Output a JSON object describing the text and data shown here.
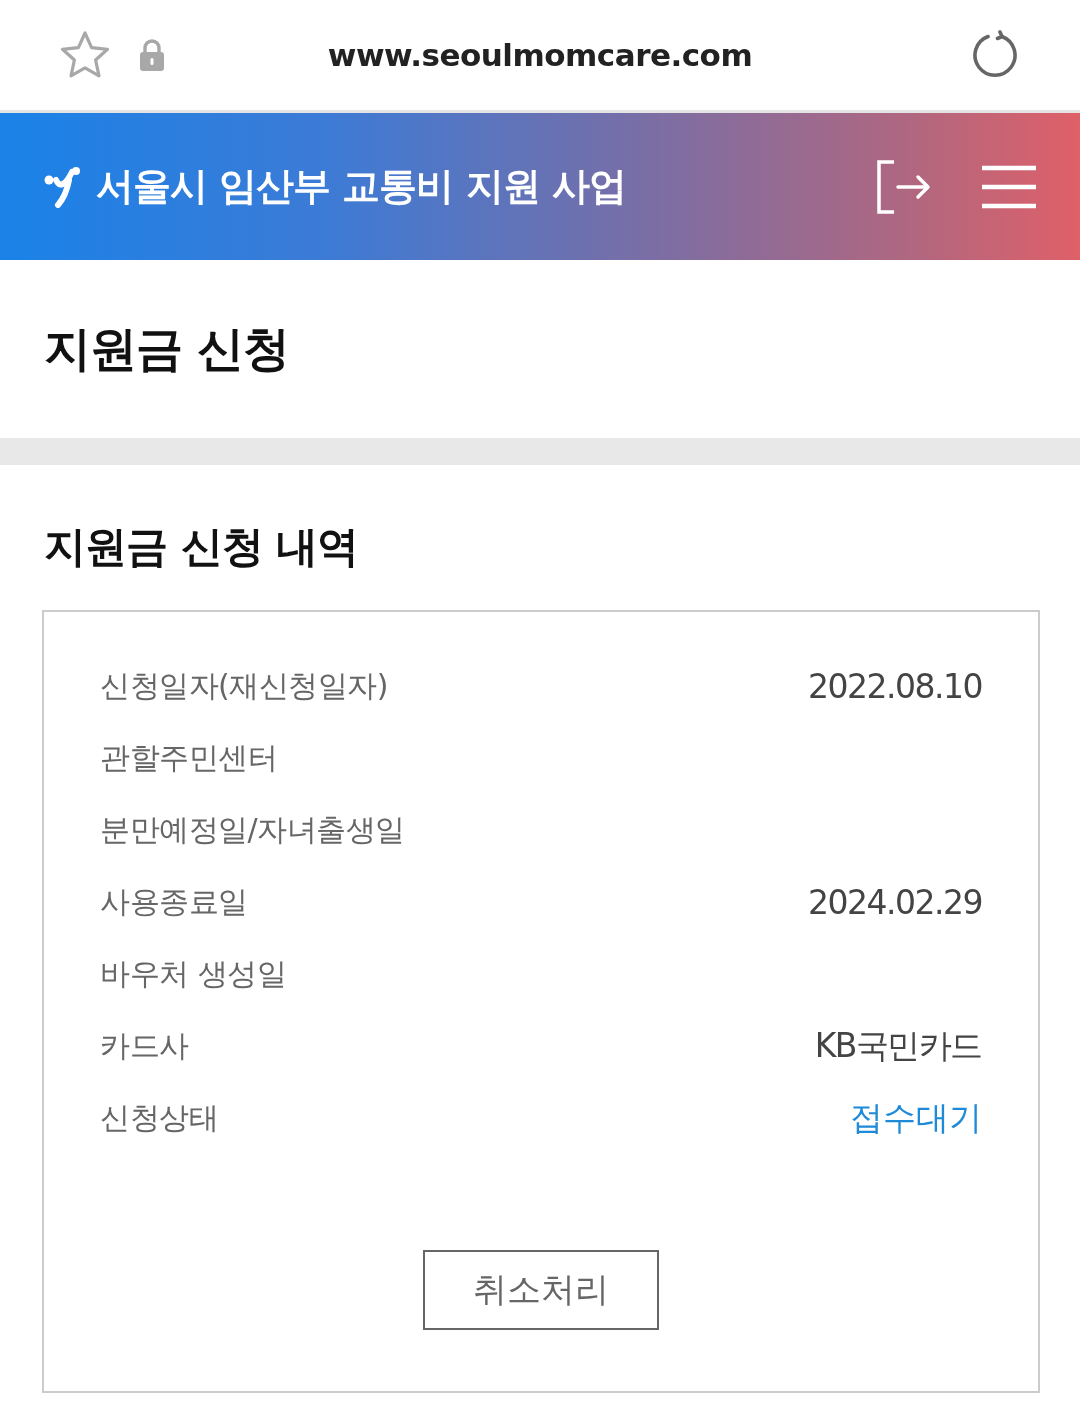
{
  "browser_bar": {
    "url": "www.seoulmomcare.com"
  },
  "header": {
    "title": "서울시 임산부 교통비 지원 사업"
  },
  "page_title": "지원금 신청",
  "history": {
    "title": "지원금 신청 내역",
    "rows": [
      {
        "label": "신청일자(재신청일자)",
        "value": "2022.08.10",
        "kind": "plain"
      },
      {
        "label": "관할주민센터"
      },
      {
        "label": "분만예정일/자녀출생일"
      },
      {
        "label": "사용종료일",
        "value": "2024.02.29",
        "kind": "plain"
      },
      {
        "label": "바우처 생성일"
      },
      {
        "label": "카드사",
        "value": "KB국민카드",
        "kind": "plain"
      },
      {
        "label": "신청상태",
        "value": "접수대기",
        "kind": "status"
      }
    ],
    "button": "취소처리"
  }
}
